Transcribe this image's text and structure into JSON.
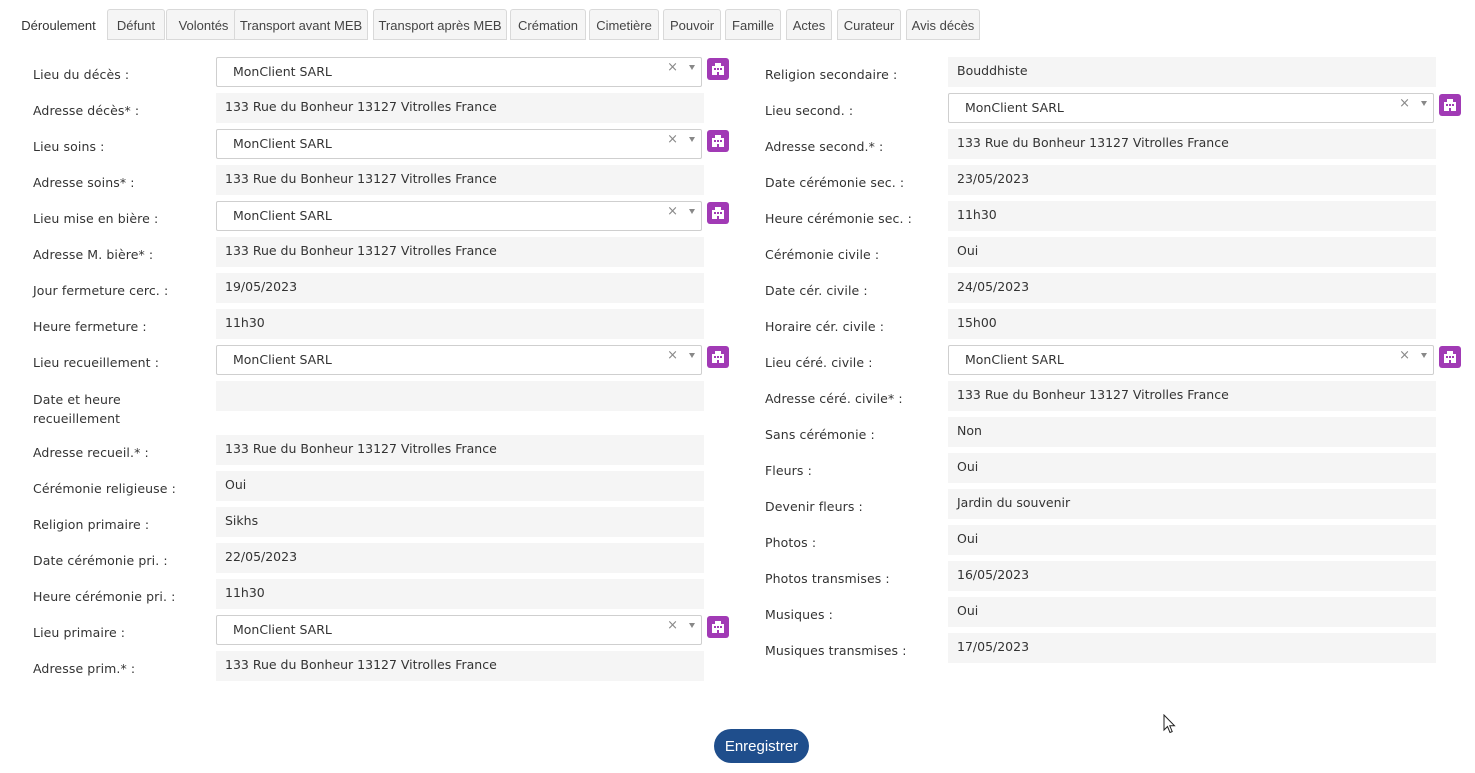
{
  "tabs": [
    "Déroulement",
    "Défunt",
    "Volontés",
    "Transport avant MEB",
    "Transport après MEB",
    "Crémation",
    "Cimetière",
    "Pouvoir",
    "Famille",
    "Actes",
    "Curateur",
    "Avis décès"
  ],
  "active_tab": "Déroulement",
  "left": {
    "lieu_deces": {
      "label": "Lieu du décès :",
      "value": "MonClient SARL"
    },
    "adresse_deces": {
      "label": "Adresse décès* :",
      "value": "133 Rue du Bonheur  13127 Vitrolles France"
    },
    "lieu_soins": {
      "label": "Lieu soins :",
      "value": "MonClient SARL"
    },
    "adresse_soins": {
      "label": "Adresse soins* :",
      "value": "133 Rue du Bonheur  13127 Vitrolles France"
    },
    "lieu_mise_biere": {
      "label": "Lieu mise en bière :",
      "value": "MonClient SARL"
    },
    "adresse_m_biere": {
      "label": "Adresse M. bière* :",
      "value": "133 Rue du Bonheur  13127 Vitrolles France"
    },
    "jour_fermeture": {
      "label": "Jour fermeture cerc. :",
      "value": "19/05/2023"
    },
    "heure_fermeture": {
      "label": "Heure fermeture :",
      "value": "11h30"
    },
    "lieu_recueillement": {
      "label": "Lieu recueillement :",
      "value": "MonClient SARL"
    },
    "date_heure_recueillement": {
      "label": "Date et heure recueillement",
      "value": ""
    },
    "adresse_recueil": {
      "label": "Adresse recueil.* :",
      "value": "133 Rue du Bonheur  13127 Vitrolles France"
    },
    "ceremonie_religieuse": {
      "label": "Cérémonie religieuse :",
      "value": "Oui"
    },
    "religion_primaire": {
      "label": "Religion primaire :",
      "value": "Sikhs"
    },
    "date_ceremonie_pri": {
      "label": "Date cérémonie pri. :",
      "value": "22/05/2023"
    },
    "heure_ceremonie_pri": {
      "label": "Heure cérémonie pri. :",
      "value": "11h30"
    },
    "lieu_primaire": {
      "label": "Lieu primaire :",
      "value": "MonClient SARL"
    },
    "adresse_prim": {
      "label": "Adresse prim.* :",
      "value": "133 Rue du Bonheur  13127 Vitrolles France"
    }
  },
  "right": {
    "religion_secondaire": {
      "label": "Religion secondaire :",
      "value": "Bouddhiste"
    },
    "lieu_second": {
      "label": "Lieu second. :",
      "value": "MonClient SARL"
    },
    "adresse_second": {
      "label": "Adresse second.* :",
      "value": "133 Rue du Bonheur  13127 Vitrolles France"
    },
    "date_ceremonie_sec": {
      "label": "Date cérémonie sec. :",
      "value": "23/05/2023"
    },
    "heure_ceremonie_sec": {
      "label": "Heure cérémonie sec. :",
      "value": "11h30"
    },
    "ceremonie_civile": {
      "label": "Cérémonie civile :",
      "value": "Oui"
    },
    "date_cer_civile": {
      "label": "Date cér. civile :",
      "value": "24/05/2023"
    },
    "horaire_cer_civile": {
      "label": "Horaire cér. civile :",
      "value": "15h00"
    },
    "lieu_cere_civile": {
      "label": "Lieu céré. civile :",
      "value": "MonClient SARL"
    },
    "adresse_cere_civile": {
      "label": "Adresse céré. civile* :",
      "value": "133 Rue du Bonheur  13127 Vitrolles France"
    },
    "sans_ceremonie": {
      "label": "Sans cérémonie :",
      "value": "Non"
    },
    "fleurs": {
      "label": "Fleurs :",
      "value": "Oui"
    },
    "devenir_fleurs": {
      "label": "Devenir fleurs :",
      "value": "Jardin du souvenir"
    },
    "photos": {
      "label": "Photos :",
      "value": "Oui"
    },
    "photos_transmises": {
      "label": "Photos transmises :",
      "value": "16/05/2023"
    },
    "musiques": {
      "label": "Musiques :",
      "value": "Oui"
    },
    "musiques_transmises": {
      "label": "Musiques transmises :",
      "value": "17/05/2023"
    }
  },
  "select_clear_glyph": "×",
  "building_icon": "building-icon",
  "accent_color": "#a13ab5",
  "save_button": "Enregistrer",
  "save_button_color": "#1f4e8c"
}
